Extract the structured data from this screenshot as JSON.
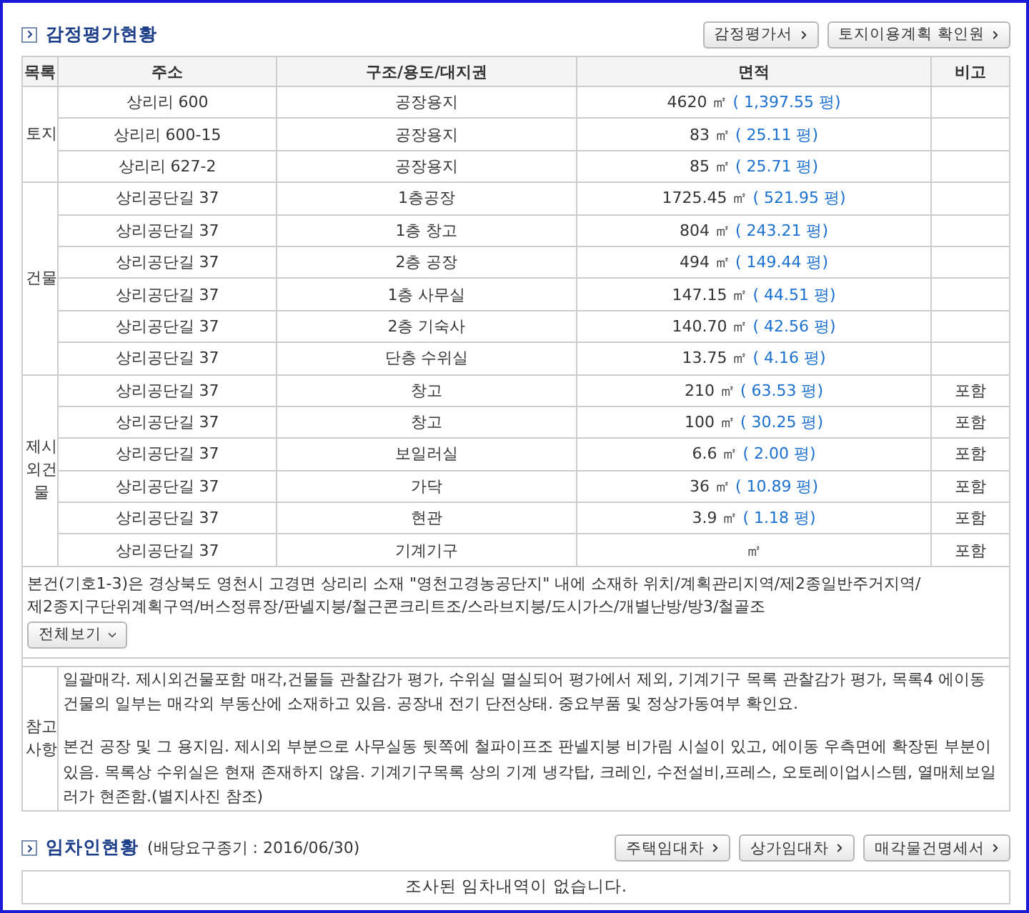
{
  "appraisal": {
    "title": "감정평가현황",
    "buttons": [
      "감정평가서",
      "토지이용계획 확인원"
    ],
    "columns": [
      "목록",
      "주소",
      "구조/용도/대지권",
      "면적",
      "비고"
    ],
    "groups": [
      {
        "label": "토지",
        "rows": [
          {
            "address": "상리리 600",
            "structure": "공장용지",
            "area": "4620 ㎡",
            "pyeong": "( 1,397.55 평)"
          },
          {
            "address": "상리리 600-15",
            "structure": "공장용지",
            "area": "83 ㎡",
            "pyeong": "( 25.11 평)"
          },
          {
            "address": "상리리 627-2",
            "structure": "공장용지",
            "area": "85 ㎡",
            "pyeong": "( 25.71 평)"
          }
        ]
      },
      {
        "label": "건물",
        "rows": [
          {
            "address": "상리공단길 37",
            "structure": "1층공장",
            "area": "1725.45 ㎡",
            "pyeong": "( 521.95 평)"
          },
          {
            "address": "상리공단길 37",
            "structure": "1층 창고",
            "area": "804 ㎡",
            "pyeong": "( 243.21 평)"
          },
          {
            "address": "상리공단길 37",
            "structure": "2층 공장",
            "area": "494 ㎡",
            "pyeong": "( 149.44 평)"
          },
          {
            "address": "상리공단길 37",
            "structure": "1층 사무실",
            "area": "147.15 ㎡",
            "pyeong": "( 44.51 평)"
          },
          {
            "address": "상리공단길 37",
            "structure": "2층 기숙사",
            "area": "140.70 ㎡",
            "pyeong": "( 42.56 평)"
          },
          {
            "address": "상리공단길 37",
            "structure": "단층 수위실",
            "area": "13.75 ㎡",
            "pyeong": "( 4.16 평)"
          }
        ]
      },
      {
        "label": "제시외건물",
        "rows": [
          {
            "address": "상리공단길 37",
            "structure": "창고",
            "area": "210 ㎡",
            "pyeong": "( 63.53 평)",
            "note": "포함"
          },
          {
            "address": "상리공단길 37",
            "structure": "창고",
            "area": "100 ㎡",
            "pyeong": "( 30.25 평)",
            "note": "포함"
          },
          {
            "address": "상리공단길 37",
            "structure": "보일러실",
            "area": "6.6 ㎡",
            "pyeong": "( 2.00 평)",
            "note": "포함"
          },
          {
            "address": "상리공단길 37",
            "structure": "가닥",
            "area": "36 ㎡",
            "pyeong": "( 10.89 평)",
            "note": "포함"
          },
          {
            "address": "상리공단길 37",
            "structure": "현관",
            "area": "3.9 ㎡",
            "pyeong": "( 1.18 평)",
            "note": "포함"
          },
          {
            "address": "상리공단길 37",
            "structure": "기계기구",
            "area": "㎡",
            "note": "포함"
          }
        ]
      }
    ],
    "summary": "본건(기호1-3)은 경상북도 영천시 고경면 상리리 소재 \"영천고경농공단지\" 내에 소재하 위치/계획관리지역/제2종일반주거지역/제2종지구단위계획구역/버스정류장/판넬지붕/철근콘크리트조/스라브지붕/도시가스/개별난방/방3/철골조",
    "expand_button": "전체보기",
    "reference": {
      "label": "참고사항",
      "paragraphs": [
        "일괄매각. 제시외건물포함 매각,건물들 관찰감가 평가, 수위실 멸실되어 평가에서 제외, 기계기구 목록 관찰감가 평가, 목록4 에이동 건물의 일부는 매각외 부동산에 소재하고 있음. 공장내 전기 단전상태. 중요부품 및 정상가동여부 확인요.",
        "본건 공장 및 그 용지임. 제시외 부분으로 사무실동 뒷쪽에 철파이프조 판넬지붕 비가림 시설이 있고, 에이동 우측면에 확장된 부분이 있음. 목록상 수위실은 현재 존재하지 않음. 기계기구목록 상의 기계 냉각탑, 크레인, 수전설비,프레스, 오토레이업시스템, 열매체보일러가 현존함.(별지사진 참조)"
      ]
    }
  },
  "tenants": {
    "title": "임차인현황",
    "subtitle": "(배당요구종기 : 2016/06/30)",
    "buttons": [
      "주택임대차",
      "상가임대차",
      "매각물건명세서"
    ],
    "message": "조사된 임차내역이 없습니다."
  }
}
